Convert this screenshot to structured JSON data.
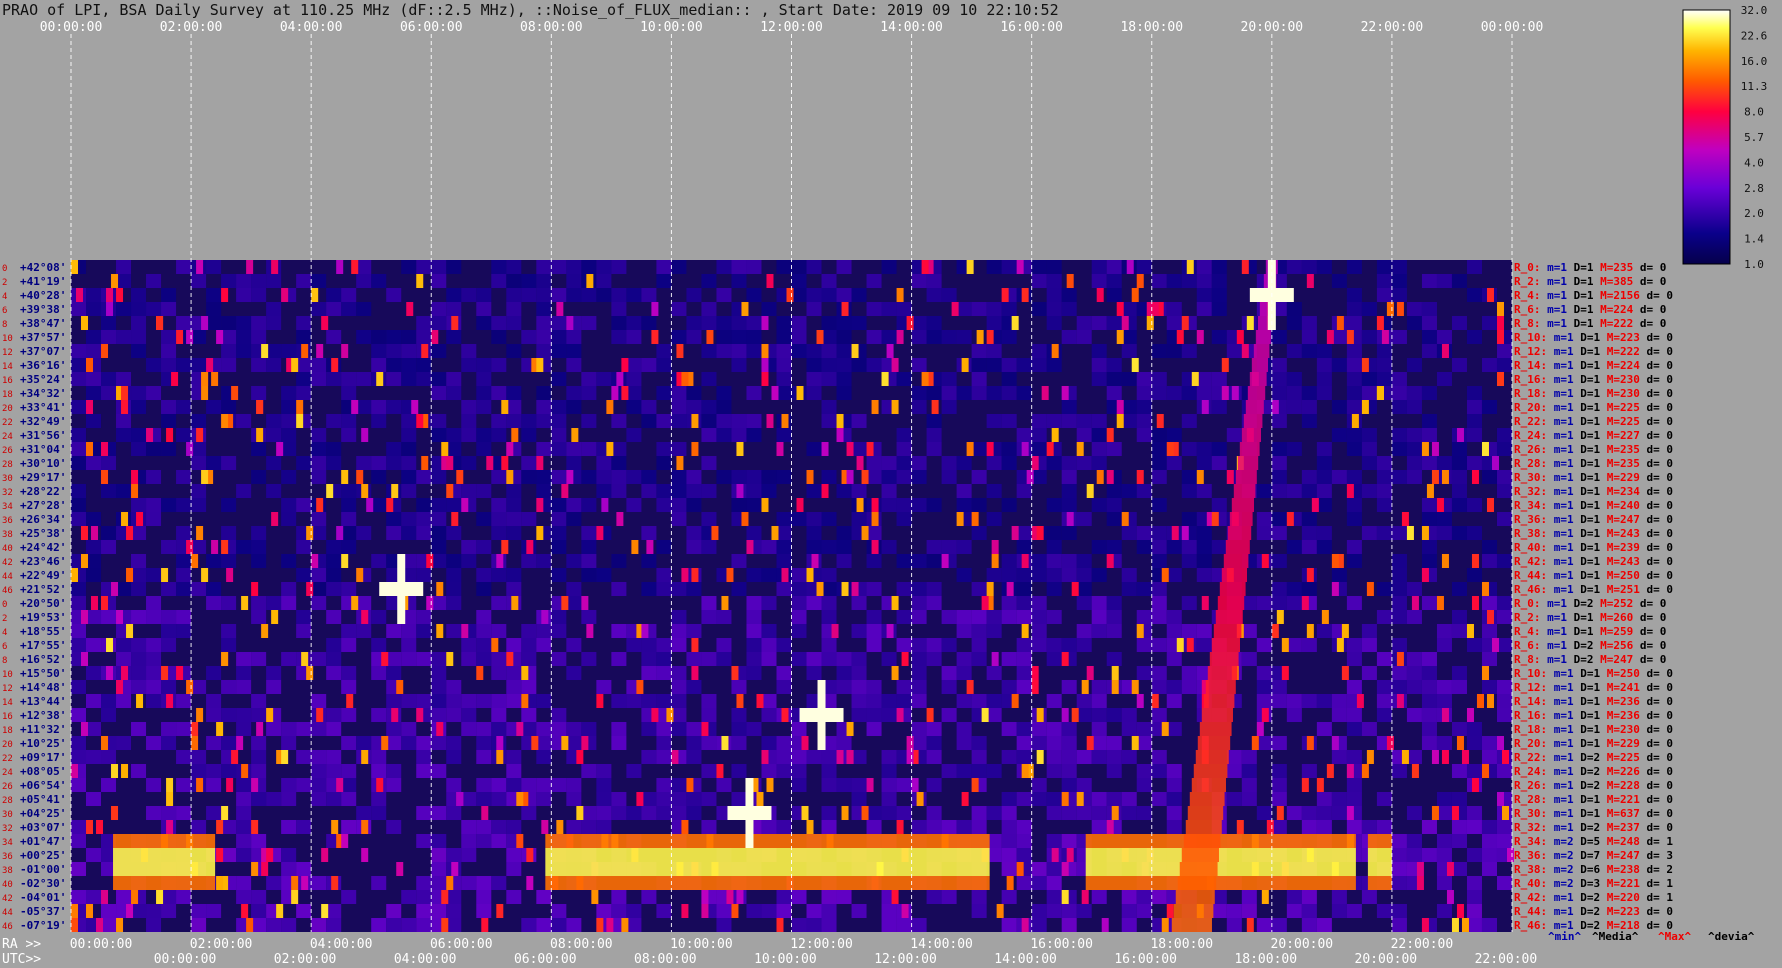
{
  "title": "PRAO of LPI, BSA Daily Survey at 110.25 MHz (dF::2.5 MHz), ::Noise_of_FLUX_median:: , Start Date: 2019 09 10 22:10:52",
  "chart_data": {
    "type": "heatmap",
    "top_time_ticks": [
      "00:00:00",
      "02:00:00",
      "04:00:00",
      "06:00:00",
      "08:00:00",
      "10:00:00",
      "12:00:00",
      "14:00:00",
      "16:00:00",
      "18:00:00",
      "20:00:00",
      "22:00:00",
      "00:00:00"
    ],
    "ra_ticks": [
      "00:00:00",
      "02:00:00",
      "04:00:00",
      "06:00:00",
      "08:00:00",
      "10:00:00",
      "12:00:00",
      "14:00:00",
      "16:00:00",
      "18:00:00",
      "20:00:00",
      "22:00:00"
    ],
    "utc_ticks": [
      "00:00:00",
      "02:00:00",
      "04:00:00",
      "06:00:00",
      "08:00:00",
      "10:00:00",
      "12:00:00",
      "14:00:00",
      "16:00:00",
      "18:00:00",
      "20:00:00",
      "22:00:00"
    ],
    "ra_label": "RA >>",
    "utc_label": "UTC>>",
    "declinations": [
      "+42°08'",
      "+41°19'",
      "+40°28'",
      "+39°38'",
      "+38°47'",
      "+37°57'",
      "+37°07'",
      "+36°16'",
      "+35°24'",
      "+34°32'",
      "+33°41'",
      "+32°49'",
      "+31°56'",
      "+31°04'",
      "+30°10'",
      "+29°17'",
      "+28°22'",
      "+27°28'",
      "+26°34'",
      "+25°38'",
      "+24°42'",
      "+23°46'",
      "+22°49'",
      "+21°52'",
      "+20°50'",
      "+19°53'",
      "+18°55'",
      "+17°55'",
      "+16°52'",
      "+15°50'",
      "+14°48'",
      "+13°44'",
      "+12°38'",
      "+11°32'",
      "+10°25'",
      "+09°17'",
      "+08°05'",
      "+06°54'",
      "+05°41'",
      "+04°25'",
      "+03°07'",
      "+01°47'",
      "+00°25'",
      "-01°00'",
      "-02°30'",
      "-04°01'",
      "-05°37'",
      "-07°19'"
    ],
    "colorbar": {
      "tick_labels": [
        "32.0",
        "22.6",
        "16.0",
        "11.3",
        "8.0",
        "5.7",
        "4.0",
        "2.8",
        "2.0",
        "1.4",
        "1.0"
      ],
      "range": [
        1.0,
        32.0
      ],
      "scale": "log"
    },
    "beam_stats_header": [
      "^min^",
      "^Media^",
      "^Max^",
      "^devia^"
    ],
    "beam_stats": [
      {
        "beam": "R_0:",
        "min": "m=1",
        "D": "D=1",
        "max": "M=235",
        "dev": "d= 0"
      },
      {
        "beam": "R_2:",
        "min": "m=1",
        "D": "D=1",
        "max": "M=385",
        "dev": "d= 0"
      },
      {
        "beam": "R_4:",
        "min": "m=1",
        "D": "D=1",
        "max": "M=2156",
        "dev": "d= 0"
      },
      {
        "beam": "R_6:",
        "min": "m=1",
        "D": "D=1",
        "max": "M=224",
        "dev": "d= 0"
      },
      {
        "beam": "R_8:",
        "min": "m=1",
        "D": "D=1",
        "max": "M=222",
        "dev": "d= 0"
      },
      {
        "beam": "R_10:",
        "min": "m=1",
        "D": "D=1",
        "max": "M=223",
        "dev": "d= 0"
      },
      {
        "beam": "R_12:",
        "min": "m=1",
        "D": "D=1",
        "max": "M=222",
        "dev": "d= 0"
      },
      {
        "beam": "R_14:",
        "min": "m=1",
        "D": "D=1",
        "max": "M=224",
        "dev": "d= 0"
      },
      {
        "beam": "R_16:",
        "min": "m=1",
        "D": "D=1",
        "max": "M=230",
        "dev": "d= 0"
      },
      {
        "beam": "R_18:",
        "min": "m=1",
        "D": "D=1",
        "max": "M=230",
        "dev": "d= 0"
      },
      {
        "beam": "R_20:",
        "min": "m=1",
        "D": "D=1",
        "max": "M=225",
        "dev": "d= 0"
      },
      {
        "beam": "R_22:",
        "min": "m=1",
        "D": "D=1",
        "max": "M=225",
        "dev": "d= 0"
      },
      {
        "beam": "R_24:",
        "min": "m=1",
        "D": "D=1",
        "max": "M=227",
        "dev": "d= 0"
      },
      {
        "beam": "R_26:",
        "min": "m=1",
        "D": "D=1",
        "max": "M=235",
        "dev": "d= 0"
      },
      {
        "beam": "R_28:",
        "min": "m=1",
        "D": "D=1",
        "max": "M=235",
        "dev": "d= 0"
      },
      {
        "beam": "R_30:",
        "min": "m=1",
        "D": "D=1",
        "max": "M=229",
        "dev": "d= 0"
      },
      {
        "beam": "R_32:",
        "min": "m=1",
        "D": "D=1",
        "max": "M=234",
        "dev": "d= 0"
      },
      {
        "beam": "R_34:",
        "min": "m=1",
        "D": "D=1",
        "max": "M=240",
        "dev": "d= 0"
      },
      {
        "beam": "R_36:",
        "min": "m=1",
        "D": "D=1",
        "max": "M=247",
        "dev": "d= 0"
      },
      {
        "beam": "R_38:",
        "min": "m=1",
        "D": "D=1",
        "max": "M=243",
        "dev": "d= 0"
      },
      {
        "beam": "R_40:",
        "min": "m=1",
        "D": "D=1",
        "max": "M=239",
        "dev": "d= 0"
      },
      {
        "beam": "R_42:",
        "min": "m=1",
        "D": "D=1",
        "max": "M=243",
        "dev": "d= 0"
      },
      {
        "beam": "R_44:",
        "min": "m=1",
        "D": "D=1",
        "max": "M=250",
        "dev": "d= 0"
      },
      {
        "beam": "R_46:",
        "min": "m=1",
        "D": "D=1",
        "max": "M=251",
        "dev": "d= 0"
      },
      {
        "beam": "R_0:",
        "min": "m=1",
        "D": "D=2",
        "max": "M=252",
        "dev": "d= 0"
      },
      {
        "beam": "R_2:",
        "min": "m=1",
        "D": "D=1",
        "max": "M=260",
        "dev": "d= 0"
      },
      {
        "beam": "R_4:",
        "min": "m=1",
        "D": "D=1",
        "max": "M=259",
        "dev": "d= 0"
      },
      {
        "beam": "R_6:",
        "min": "m=1",
        "D": "D=2",
        "max": "M=256",
        "dev": "d= 0"
      },
      {
        "beam": "R_8:",
        "min": "m=1",
        "D": "D=2",
        "max": "M=247",
        "dev": "d= 0"
      },
      {
        "beam": "R_10:",
        "min": "m=1",
        "D": "D=1",
        "max": "M=250",
        "dev": "d= 0"
      },
      {
        "beam": "R_12:",
        "min": "m=1",
        "D": "D=1",
        "max": "M=241",
        "dev": "d= 0"
      },
      {
        "beam": "R_14:",
        "min": "m=1",
        "D": "D=1",
        "max": "M=236",
        "dev": "d= 0"
      },
      {
        "beam": "R_16:",
        "min": "m=1",
        "D": "D=1",
        "max": "M=236",
        "dev": "d= 0"
      },
      {
        "beam": "R_18:",
        "min": "m=1",
        "D": "D=1",
        "max": "M=230",
        "dev": "d= 0"
      },
      {
        "beam": "R_20:",
        "min": "m=1",
        "D": "D=1",
        "max": "M=229",
        "dev": "d= 0"
      },
      {
        "beam": "R_22:",
        "min": "m=1",
        "D": "D=2",
        "max": "M=225",
        "dev": "d= 0"
      },
      {
        "beam": "R_24:",
        "min": "m=1",
        "D": "D=2",
        "max": "M=226",
        "dev": "d= 0"
      },
      {
        "beam": "R_26:",
        "min": "m=1",
        "D": "D=2",
        "max": "M=228",
        "dev": "d= 0"
      },
      {
        "beam": "R_28:",
        "min": "m=1",
        "D": "D=1",
        "max": "M=221",
        "dev": "d= 0"
      },
      {
        "beam": "R_30:",
        "min": "m=1",
        "D": "D=1",
        "max": "M=637",
        "dev": "d= 0"
      },
      {
        "beam": "R_32:",
        "min": "m=1",
        "D": "D=2",
        "max": "M=237",
        "dev": "d= 0"
      },
      {
        "beam": "R_34:",
        "min": "m=2",
        "D": "D=5",
        "max": "M=248",
        "dev": "d= 1"
      },
      {
        "beam": "R_36:",
        "min": "m=2",
        "D": "D=7",
        "max": "M=247",
        "dev": "d= 3"
      },
      {
        "beam": "R_38:",
        "min": "m=2",
        "D": "D=6",
        "max": "M=238",
        "dev": "d= 2"
      },
      {
        "beam": "R_40:",
        "min": "m=2",
        "D": "D=3",
        "max": "M=221",
        "dev": "d= 1"
      },
      {
        "beam": "R_42:",
        "min": "m=1",
        "D": "D=2",
        "max": "M=220",
        "dev": "d= 1"
      },
      {
        "beam": "R_44:",
        "min": "m=1",
        "D": "D=2",
        "max": "M=223",
        "dev": "d= 0"
      },
      {
        "beam": "R_46:",
        "min": "m=1",
        "D": "D=2",
        "max": "M=218",
        "dev": "d= 0"
      }
    ],
    "colors": {
      "background": "#a3a3a3",
      "ra_index_color": "#cc0000",
      "dec_label_color": "#000080",
      "grid_color": "#ffffff",
      "beam_label_color": "#ee0000",
      "min_color": "#0000aa",
      "max_color": "#ee0000"
    }
  }
}
